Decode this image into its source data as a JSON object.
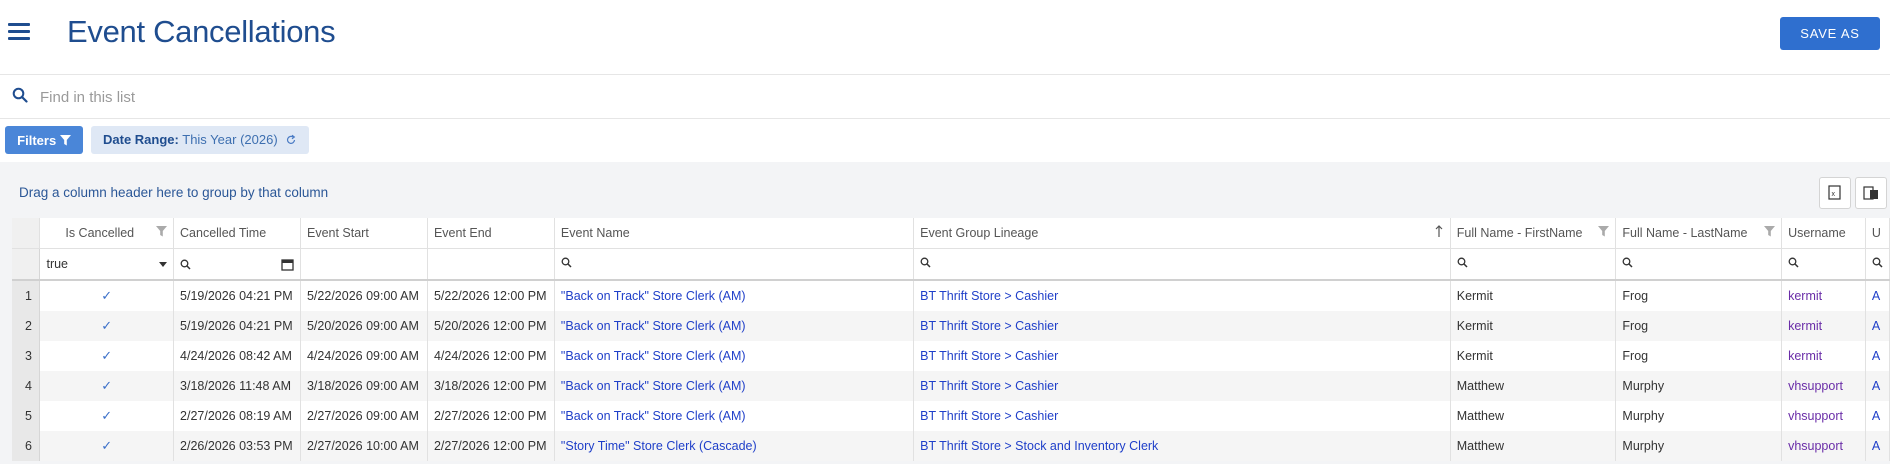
{
  "header": {
    "title": "Event Cancellations",
    "save_label": "SAVE AS"
  },
  "search": {
    "placeholder": "Find in this list"
  },
  "filters": {
    "button_label": "Filters",
    "chip_label": "Date Range:",
    "chip_value": "This Year (2026)"
  },
  "grid": {
    "group_hint": "Drag a column header here to group by that column",
    "columns": [
      "Is Cancelled",
      "Cancelled Time",
      "Event Start",
      "Event End",
      "Event Name",
      "Event Group Lineage",
      "Full Name - FirstName",
      "Full Name - LastName",
      "Username",
      "U"
    ],
    "filter_is_cancelled": "true",
    "sort_column": "Event Group Lineage",
    "rows": [
      {
        "n": "1",
        "time": "5/19/2026 04:21 PM",
        "start": "5/22/2026 09:00 AM",
        "end": "5/22/2026 12:00 PM",
        "event": "\"Back on Track\" Store Clerk (AM)",
        "lineage": "BT Thrift Store > Cashier",
        "first": "Kermit",
        "last": "Frog",
        "user": "kermit",
        "extra": "A"
      },
      {
        "n": "2",
        "time": "5/19/2026 04:21 PM",
        "start": "5/20/2026 09:00 AM",
        "end": "5/20/2026 12:00 PM",
        "event": "\"Back on Track\" Store Clerk (AM)",
        "lineage": "BT Thrift Store > Cashier",
        "first": "Kermit",
        "last": "Frog",
        "user": "kermit",
        "extra": "A"
      },
      {
        "n": "3",
        "time": "4/24/2026 08:42 AM",
        "start": "4/24/2026 09:00 AM",
        "end": "4/24/2026 12:00 PM",
        "event": "\"Back on Track\" Store Clerk (AM)",
        "lineage": "BT Thrift Store > Cashier",
        "first": "Kermit",
        "last": "Frog",
        "user": "kermit",
        "extra": "A"
      },
      {
        "n": "4",
        "time": "3/18/2026 11:48 AM",
        "start": "3/18/2026 09:00 AM",
        "end": "3/18/2026 12:00 PM",
        "event": "\"Back on Track\" Store Clerk (AM)",
        "lineage": "BT Thrift Store > Cashier",
        "first": "Matthew",
        "last": "Murphy",
        "user": "vhsupport",
        "extra": "A"
      },
      {
        "n": "5",
        "time": "2/27/2026 08:19 AM",
        "start": "2/27/2026 09:00 AM",
        "end": "2/27/2026 12:00 PM",
        "event": "\"Back on Track\" Store Clerk (AM)",
        "lineage": "BT Thrift Store > Cashier",
        "first": "Matthew",
        "last": "Murphy",
        "user": "vhsupport",
        "extra": "A"
      },
      {
        "n": "6",
        "time": "2/26/2026 03:53 PM",
        "start": "2/27/2026 10:00 AM",
        "end": "2/27/2026 12:00 PM",
        "event": "\"Story Time\" Store Clerk (Cascade)",
        "lineage": "BT Thrift Store > Stock and Inventory Clerk",
        "first": "Matthew",
        "last": "Murphy",
        "user": "vhsupport",
        "extra": "A"
      }
    ]
  },
  "colors": {
    "brand": "#1f4d8f",
    "accent": "#2f6fcf",
    "link": "#1f3fc9",
    "user_link": "#6a2da8"
  }
}
